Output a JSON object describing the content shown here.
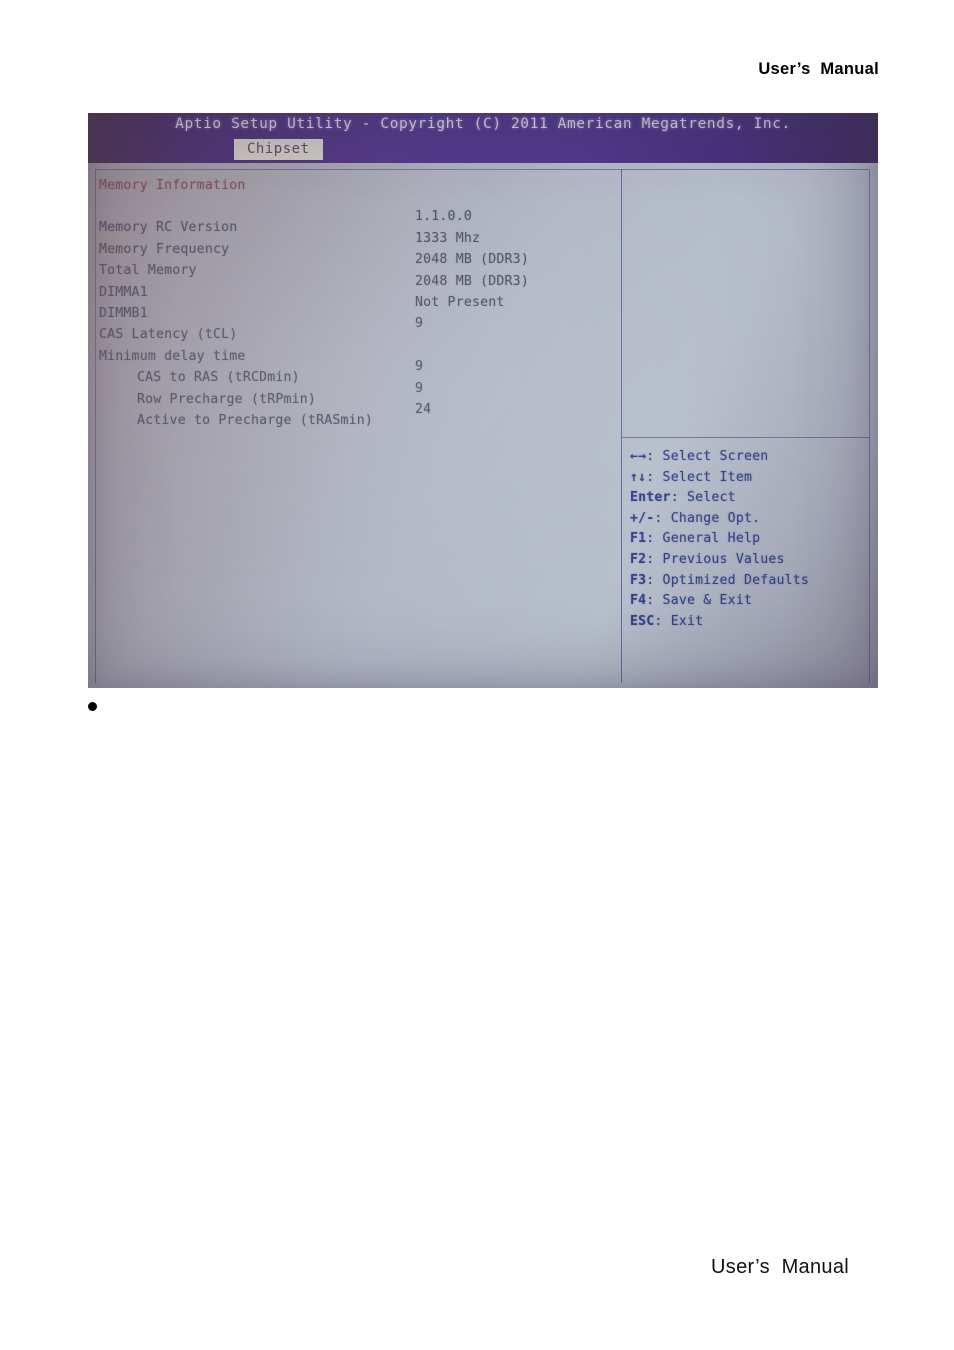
{
  "page": {
    "header_text": "User’s  Manual",
    "footer_text": "User’s  Manual",
    "bullet_text": ""
  },
  "bios": {
    "title": "Aptio Setup Utility - Copyright (C) 2011 American Megatrends, Inc.",
    "active_tab": "Chipset",
    "section_heading": "Memory Information",
    "colors": {
      "titlebar_purple": "#4b2f84",
      "tab_background": "#cfcbc6",
      "body_gray": "#b2b8c6",
      "heading_red": "#7b4752",
      "label_text": "#4a4b5e",
      "help_blue": "#2f3c86"
    },
    "rows": [
      {
        "label": "Memory RC Version",
        "value": "1.1.0.0",
        "indent": false
      },
      {
        "label": "Memory Frequency",
        "value": "1333 Mhz",
        "indent": false
      },
      {
        "label": "Total Memory",
        "value": "2048 MB (DDR3)",
        "indent": false
      },
      {
        "label": "DIMMA1",
        "value": "2048 MB (DDR3)",
        "indent": false
      },
      {
        "label": "DIMMB1",
        "value": "Not Present",
        "indent": false
      },
      {
        "label": "CAS Latency (tCL)",
        "value": "9",
        "indent": false
      },
      {
        "label": "Minimum delay time",
        "value": "",
        "indent": false
      },
      {
        "label": "CAS to RAS (tRCDmin)",
        "value": "9",
        "indent": true
      },
      {
        "label": "Row Precharge (tRPmin)",
        "value": "9",
        "indent": true
      },
      {
        "label": "Active to Precharge (tRASmin)",
        "value": "24",
        "indent": true
      }
    ],
    "help_keys": [
      {
        "key": "←→",
        "action": ": Select Screen"
      },
      {
        "key": "↑↓",
        "action": ": Select Item"
      },
      {
        "key": "Enter",
        "action": ": Select"
      },
      {
        "key": "+/-",
        "action": ": Change Opt."
      },
      {
        "key": "F1",
        "action": ": General Help"
      },
      {
        "key": "F2",
        "action": ": Previous Values"
      },
      {
        "key": "F3",
        "action": ": Optimized Defaults"
      },
      {
        "key": "F4",
        "action": ": Save & Exit"
      },
      {
        "key": "ESC",
        "action": ": Exit"
      }
    ]
  }
}
